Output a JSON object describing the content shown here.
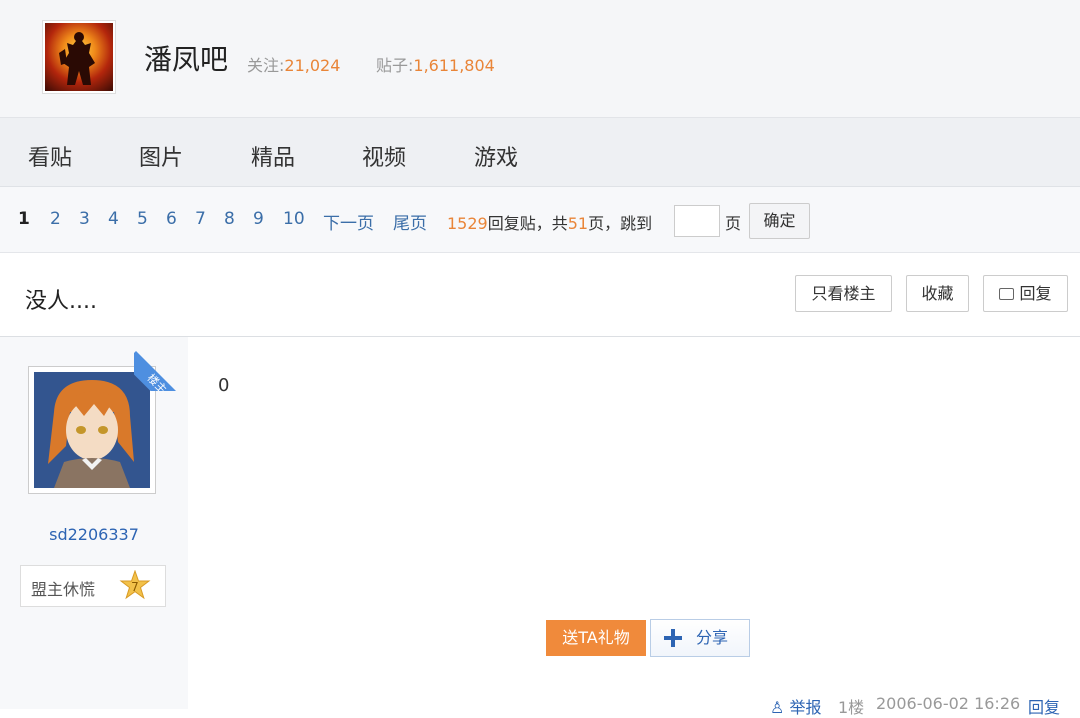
{
  "header": {
    "forum_name": "潘凤吧",
    "follow_label": "关注:",
    "follow_count": "21,024",
    "posts_label": "贴子:",
    "posts_count": "1,611,804"
  },
  "nav": {
    "items": [
      "看贴",
      "图片",
      "精品",
      "视频",
      "游戏"
    ]
  },
  "pager": {
    "current": "1",
    "pages": [
      "2",
      "3",
      "4",
      "5",
      "6",
      "7",
      "8",
      "9",
      "10"
    ],
    "next_label": "下一页",
    "last_label": "尾页",
    "reply_count": "1529",
    "reply_label": "回复贴，共",
    "total_pages": "51",
    "total_suffix": "页，跳到",
    "page_label": "页",
    "confirm_label": "确定"
  },
  "thread": {
    "title": "没人....",
    "only_op_label": "只看楼主",
    "favorite_label": "收藏",
    "reply_label": "回复"
  },
  "post": {
    "op_badge": "楼主",
    "username": "sd2206337",
    "level_title": "盟主休慌",
    "level_num": "7",
    "content": "0",
    "gift_label": "送TA礼物",
    "share_label": "分享",
    "report_label": "举报",
    "floor": "1楼",
    "time": "2006-06-02 16:26",
    "reply_label": "回复"
  },
  "colors": {
    "accent_orange": "#e98538",
    "link_blue": "#2d64b3",
    "gift_orange": "#f08a3b"
  }
}
